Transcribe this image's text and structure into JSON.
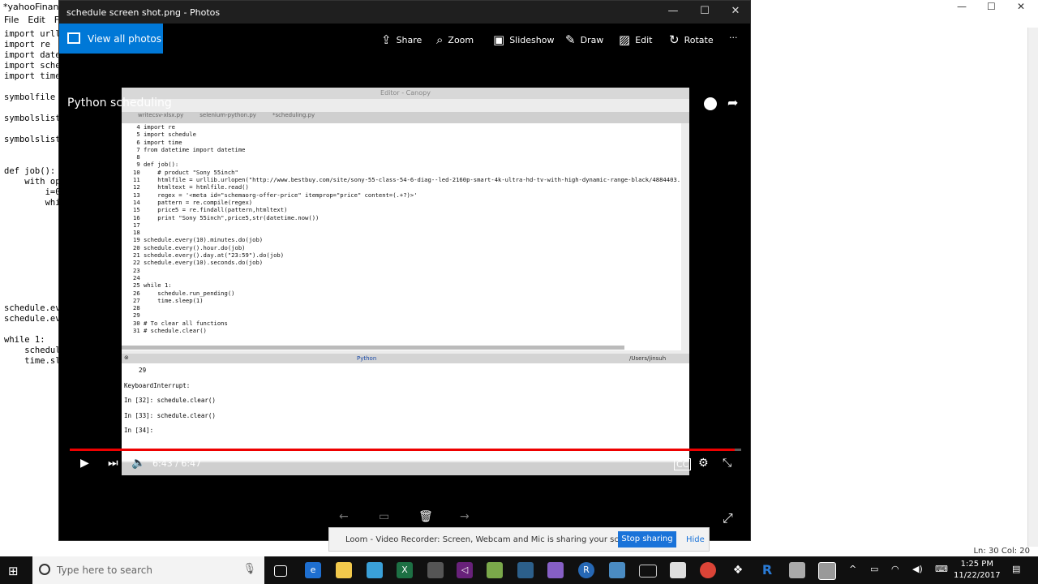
{
  "background_editor": {
    "title": "*yahooFinan",
    "menu": [
      "File",
      "Edit",
      "For"
    ],
    "code_lines": [
      "import urlli",
      "import re",
      "import date",
      "import sche",
      "import time",
      "",
      "symbolfile",
      "",
      "symbolslist",
      "",
      "symbolslist",
      "",
      "",
      "def job():",
      "    with op",
      "        i=0",
      "        whi",
      "",
      "",
      "",
      "",
      "",
      "",
      "",
      "",
      "",
      "schedule.ev",
      "schedule.ev",
      "",
      "while 1:",
      "    schedul",
      "    time.sl"
    ],
    "status": "Ln: 30   Col: 20"
  },
  "photos": {
    "window_title": "schedule screen shot.png - Photos",
    "view_all": "View all photos",
    "toolbar": {
      "share": "Share",
      "zoom": "Zoom",
      "slideshow": "Slideshow",
      "draw": "Draw",
      "edit": "Edit",
      "rotate": "Rotate",
      "more": "···"
    }
  },
  "video": {
    "title": "Python scheduling",
    "time": "6:43 / 6:47",
    "progress": 0.99,
    "screen": {
      "editor_title": "Editor - Canopy",
      "tabs": [
        "writecsv-xlsx.py",
        "selenium-python.py",
        "*scheduling.py"
      ],
      "code_lines": [
        " 4 import re",
        " 5 import schedule",
        " 6 import time",
        " 7 from datetime import datetime",
        " 8",
        " 9 def job():",
        "10     # product \"Sony 55inch\"",
        "11     htmlfile = urllib.urlopen(\"http://www.bestbuy.com/site/sony-55-class-54-6-diag--led-2160p-smart-4k-ultra-hd-tv-with-high-dynamic-range-black/4884403.",
        "12     htmltext = htmlfile.read()",
        "13     regex = '<meta id=\"schemaorg-offer-price\" itemprop=\"price\" content=(.+?)>'",
        "14     pattern = re.compile(regex)",
        "15     price5 = re.findall(pattern,htmltext)",
        "16     print \"Sony 55inch\",price5,str(datetime.now())",
        "17",
        "18",
        "19 schedule.every(10).minutes.do(job)",
        "20 schedule.every().hour.do(job)",
        "21 schedule.every().day.at(\"23:59\").do(job)",
        "22 schedule.every(10).seconds.do(job)",
        "23",
        "24",
        "25 while 1:",
        "26     schedule.run_pending()",
        "27     time.sleep(1)",
        "28",
        "29",
        "30 # To clear all functions",
        "31 # schedule.clear()"
      ],
      "console_header": "Python",
      "console_path": "/Users/jinsuh",
      "console_lines": [
        "    29",
        "KeyboardInterrupt:",
        "In [32]: schedule.clear()",
        "In [33]: schedule.clear()",
        "In [34]:"
      ]
    }
  },
  "loom": {
    "message": "Loom - Video Recorder: Screen, Webcam and Mic is sharing your screen.",
    "stop_label": "Stop sharing",
    "hide_label": "Hide"
  },
  "taskbar": {
    "search_placeholder": "Type here to search",
    "time": "1:25 PM",
    "date": "11/22/2017"
  }
}
